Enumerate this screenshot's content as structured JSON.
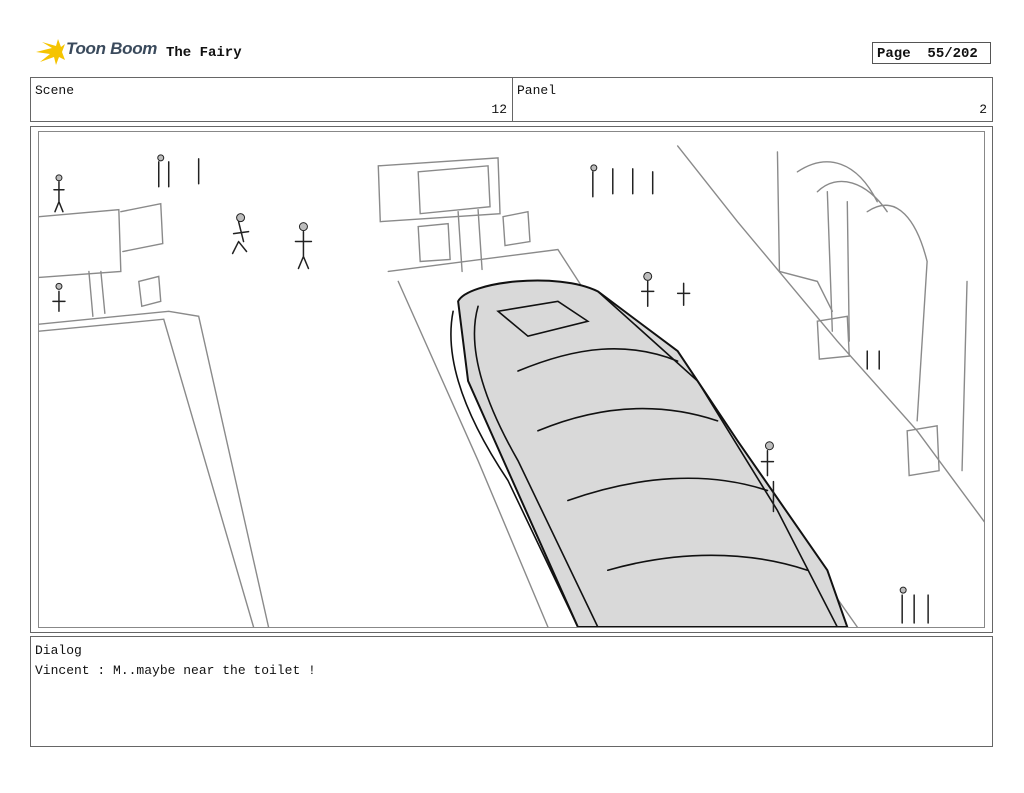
{
  "header": {
    "logo_text": "Toon Boom",
    "title": "The Fairy",
    "page_label": "Page",
    "page_value": "55/202"
  },
  "info": {
    "scene_label": "Scene",
    "scene_value": "12",
    "panel_label": "Panel",
    "panel_value": "2"
  },
  "panel_image": {
    "icon": "storyboard-sketch-bus-station"
  },
  "dialog": {
    "label": "Dialog",
    "text": "Vincent : M..maybe near the toilet !"
  },
  "colors": {
    "logo_yellow": "#f5c400",
    "logo_text": "#3a4a5c",
    "sketch_fill": "#d9d9d9"
  }
}
